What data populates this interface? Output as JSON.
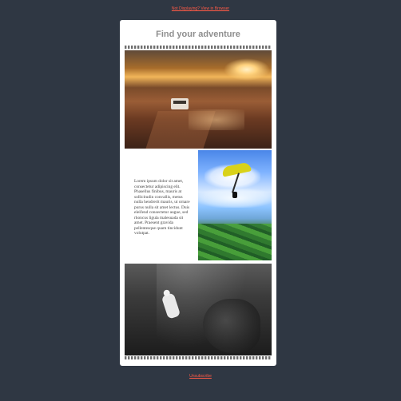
{
  "header": {
    "view_in_browser": "Not Displaying? View in Browser"
  },
  "card": {
    "title": "Find your adventure",
    "body_text": "Lorem ipsum dolor sit amet, consectetur adipiscing elit. Phasellus finibus, mauris at sollicitudin convallis, metus nulla hendrerit mauris, ut ornare purus nulla sit amet lectus. Duis eleifend consectetur augue, sed rhoncus ligula malesuada sit amet. Praesent gravida pellentesque quam tincidunt volutpat."
  },
  "footer": {
    "unsubscribe": "Unsubscribe"
  },
  "colors": {
    "background": "#2f3743",
    "accent": "#ff5a46",
    "card": "#ffffff",
    "title": "#8e8e8e"
  }
}
